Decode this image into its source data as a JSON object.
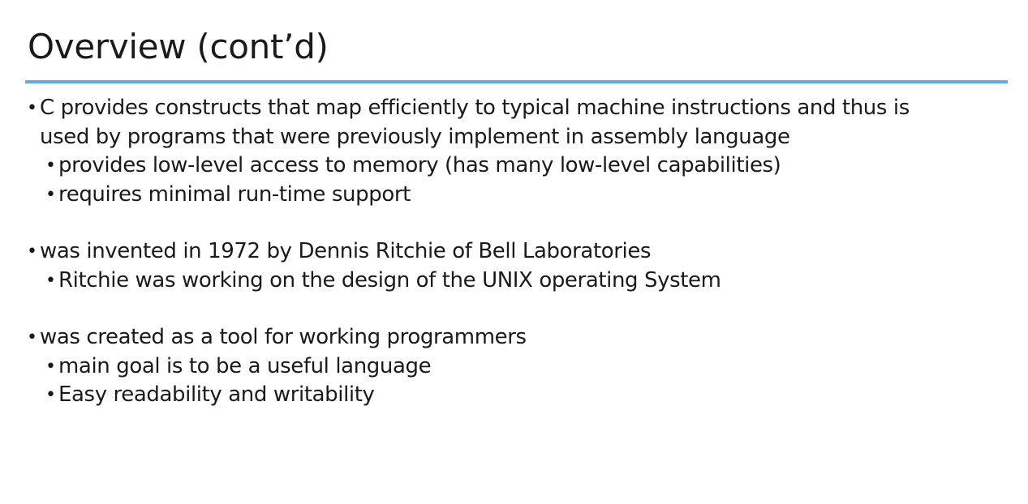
{
  "slide": {
    "title": "Overview (cont’d)",
    "bullet_glyph": "•",
    "groups": [
      {
        "text": "C provides constructs that map efficiently to typical machine instructions and thus is used by programs that were previously implement in assembly language",
        "line1": "C provides constructs that map efficiently to typical machine instructions and thus is",
        "line2": "used by programs that were previously implement in assembly language",
        "subs": [
          "provides low-level access to memory (has many low-level capabilities)",
          "requires minimal run-time support"
        ]
      },
      {
        "text": "was invented in 1972 by Dennis Ritchie of Bell Laboratories",
        "subs": [
          "Ritchie was working on the design of the UNIX operating System"
        ]
      },
      {
        "text": "was created as a tool for working programmers",
        "subs": [
          "main goal is to be a useful language",
          "Easy readability and writability"
        ]
      }
    ]
  },
  "colors": {
    "accent_rule": "#64a8e8",
    "text": "#1a1a1a",
    "background": "#ffffff"
  }
}
